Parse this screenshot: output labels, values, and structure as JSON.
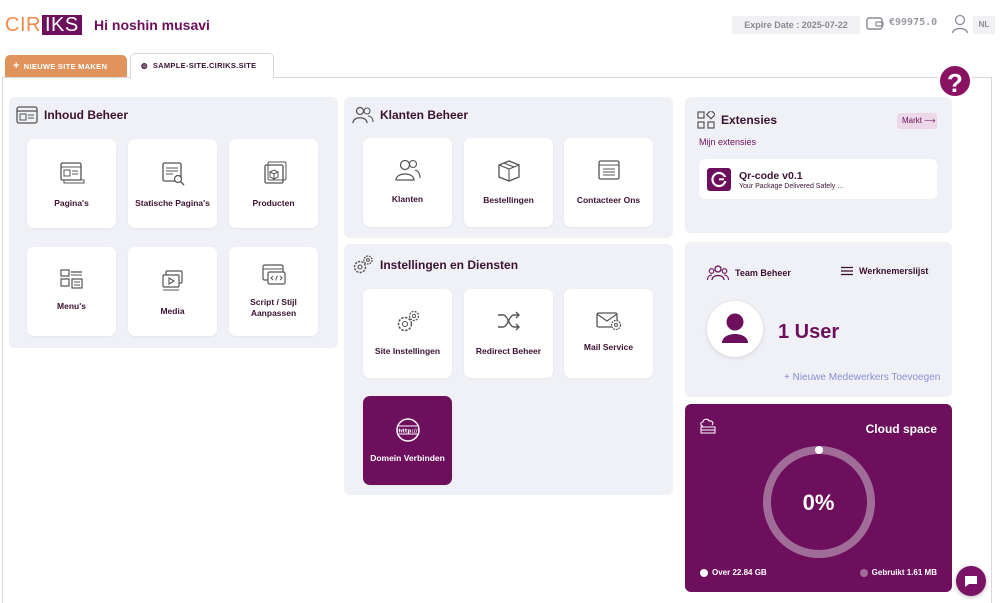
{
  "header": {
    "logo_left": "CIR",
    "logo_right": "IKS",
    "greeting": "Hi noshin musavi",
    "expire": "Expire Date : 2025-07-22",
    "balance": "€99975.0",
    "lang": "NL"
  },
  "tabs": {
    "new_site": "NIEUWE SITE MAKEN",
    "current_site": "SAMPLE-SITE.CIRIKS.SITE"
  },
  "help_label": "?",
  "content_panel": {
    "title": "Inhoud Beheer",
    "cards": [
      {
        "label": "Pagina's"
      },
      {
        "label": "Statische Pagina's"
      },
      {
        "label": "Producten"
      },
      {
        "label": "Menu's"
      },
      {
        "label": "Media"
      },
      {
        "label": "Script / Stijl Aanpassen"
      }
    ]
  },
  "customers_panel": {
    "title": "Klanten Beheer",
    "cards": [
      {
        "label": "Klanten"
      },
      {
        "label": "Bestellingen"
      },
      {
        "label": "Contacteer Ons"
      }
    ]
  },
  "settings_panel": {
    "title": "Instellingen en Diensten",
    "cards": [
      {
        "label": "Site Instellingen"
      },
      {
        "label": "Redirect Beheer"
      },
      {
        "label": "Mail Service"
      },
      {
        "label": "Domein Verbinden"
      }
    ]
  },
  "extensions": {
    "title": "Extensies",
    "market": "Markt",
    "subtitle": "Mijn extensies",
    "items": [
      {
        "name": "Qr-code v0.1",
        "description": "Your Package Delivered Safely ..."
      }
    ]
  },
  "team": {
    "team_link": "Team Beheer",
    "staff_list": "Werknemerslijst",
    "users": "1 User",
    "add_staff": "+ Nieuwe Medewerkers Toevoegen"
  },
  "cloud": {
    "title": "Cloud space",
    "percent_label": "0%",
    "usage_fraction": 0.0,
    "free": "Over 22.84 GB",
    "used": "Gebruikt 1.61 MB"
  },
  "colors": {
    "brand": "#6d0f5c",
    "accent_orange": "#e0935d",
    "panel_bg": "#f0f1f6"
  }
}
